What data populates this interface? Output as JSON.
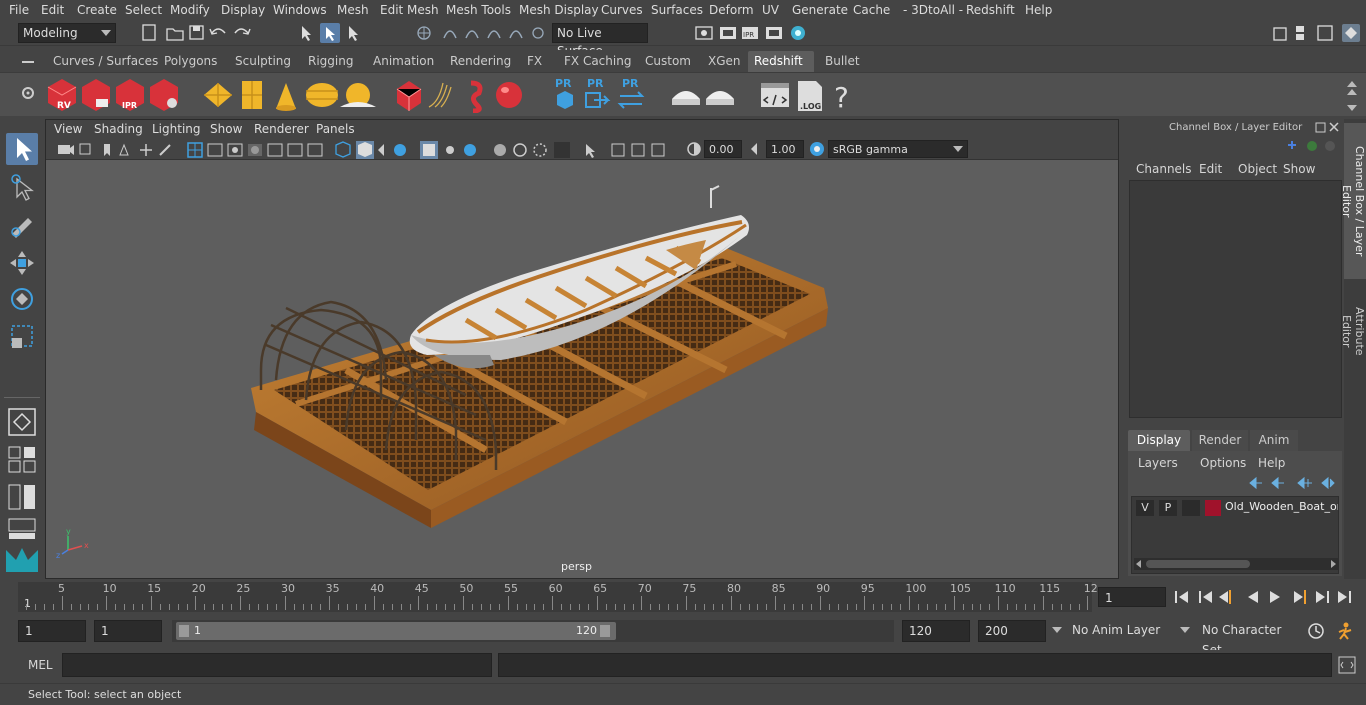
{
  "menubar": {
    "items": [
      "File",
      "Edit",
      "Create",
      "Select",
      "Modify",
      "Display",
      "Windows",
      "Mesh",
      "Edit Mesh",
      "Mesh Tools",
      "Mesh Display",
      "Curves",
      "Surfaces",
      "Deform",
      "UV",
      "Generate",
      "Cache",
      "- 3DtoAll -",
      "Redshift",
      "Help"
    ]
  },
  "statusline": {
    "mode": "Modeling",
    "live_surface": "No Live Surface"
  },
  "shelf": {
    "tabs": [
      "Curves / Surfaces",
      "Polygons",
      "Sculpting",
      "Rigging",
      "Animation",
      "Rendering",
      "FX",
      "FX Caching",
      "Custom",
      "XGen",
      "Redshift",
      "Bullet"
    ],
    "active_tab": "Redshift",
    "icon_labels": [
      "RV",
      "IPR",
      "PR",
      "PR",
      "PR",
      ".LOG",
      "?"
    ]
  },
  "viewport": {
    "menus": [
      "View",
      "Shading",
      "Lighting",
      "Show",
      "Renderer",
      "Panels"
    ],
    "exposure": "0.00",
    "gamma": "1.00",
    "color_space": "sRGB gamma",
    "camera_label": "persp"
  },
  "channel_box": {
    "title": "Channel Box / Layer Editor",
    "menus": [
      "Channels",
      "Edit",
      "Object",
      "Show"
    ]
  },
  "layer_editor": {
    "tabs": [
      "Display",
      "Render",
      "Anim"
    ],
    "active_tab": "Display",
    "menus": [
      "Layers",
      "Options",
      "Help"
    ],
    "layer": {
      "v": "V",
      "p": "P",
      "name": "Old_Wooden_Boat_or",
      "color": "#a0122b"
    }
  },
  "side_tabs": [
    "Channel Box / Layer Editor",
    "Attribute Editor"
  ],
  "timeslider": {
    "ticks": [
      "5",
      "10",
      "15",
      "20",
      "25",
      "30",
      "35",
      "40",
      "45",
      "50",
      "55",
      "60",
      "65",
      "70",
      "75",
      "80",
      "85",
      "90",
      "95",
      "100",
      "105",
      "110",
      "115",
      "12"
    ],
    "start_label": "1",
    "current_frame": "1"
  },
  "rangeslider": {
    "start": "1",
    "playback_start": "1",
    "range_start_label": "1",
    "range_end_label": "120",
    "playback_end": "120",
    "end": "200",
    "anim_layer": "No Anim Layer",
    "character_set": "No Character Set"
  },
  "cmdline": {
    "label": "MEL"
  },
  "helpline": {
    "text": "Select Tool: select an object"
  },
  "colors": {
    "accent": "#4a9fd8",
    "redshift_red": "#d8323a",
    "wood": "#b8732a"
  }
}
